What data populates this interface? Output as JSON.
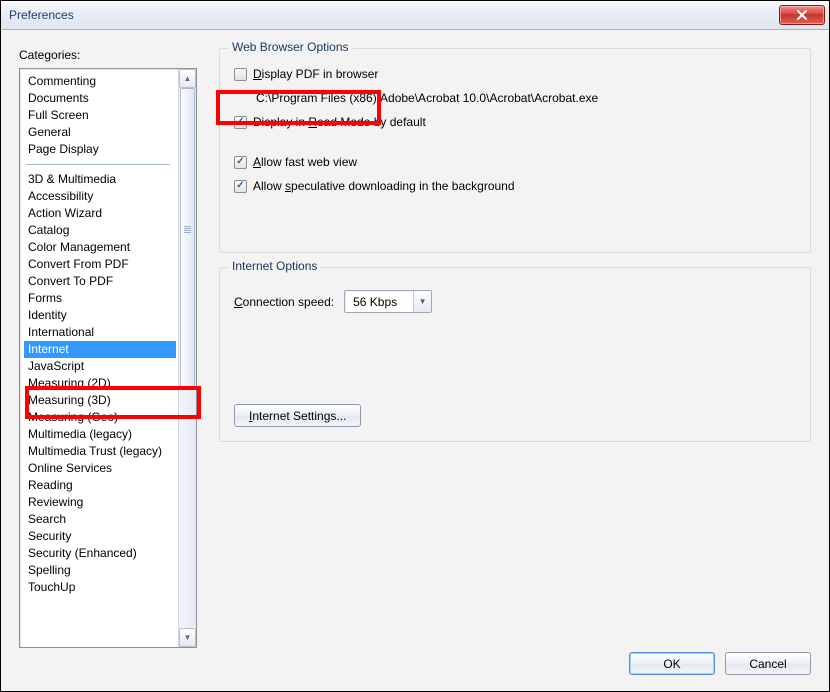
{
  "window": {
    "title": "Preferences"
  },
  "sidebar": {
    "label": "Categories:",
    "group1": [
      "Commenting",
      "Documents",
      "Full Screen",
      "General",
      "Page Display"
    ],
    "group2": [
      "3D & Multimedia",
      "Accessibility",
      "Action Wizard",
      "Catalog",
      "Color Management",
      "Convert From PDF",
      "Convert To PDF",
      "Forms",
      "Identity",
      "International",
      "Internet",
      "JavaScript",
      "Measuring (2D)",
      "Measuring (3D)",
      "Measuring (Geo)",
      "Multimedia (legacy)",
      "Multimedia Trust (legacy)",
      "Online Services",
      "Reading",
      "Reviewing",
      "Search",
      "Security",
      "Security (Enhanced)",
      "Spelling",
      "TouchUp"
    ],
    "selected": "Internet"
  },
  "web_browser_options": {
    "group_title": "Web Browser Options",
    "display_pdf": {
      "label_pre": "",
      "label_u": "D",
      "label_post": "isplay PDF in browser",
      "checked": false
    },
    "path": "C:\\Program Files (x86)\\Adobe\\Acrobat 10.0\\Acrobat\\Acrobat.exe",
    "read_mode": {
      "label_pre": "Display in ",
      "label_u": "R",
      "label_post": "ead Mode by default",
      "checked": true
    },
    "fast_web": {
      "label_pre": "",
      "label_u": "A",
      "label_post": "llow fast web view",
      "checked": true
    },
    "speculative": {
      "label_pre": "Allow ",
      "label_u": "s",
      "label_post": "peculative downloading in the background",
      "checked": true
    }
  },
  "internet_options": {
    "group_title": "Internet Options",
    "conn_label_pre": "",
    "conn_label_u": "C",
    "conn_label_post": "onnection speed:",
    "conn_value": "56 Kbps",
    "settings_pre": "",
    "settings_u": "I",
    "settings_post": "nternet Settings..."
  },
  "buttons": {
    "ok": "OK",
    "cancel": "Cancel"
  }
}
